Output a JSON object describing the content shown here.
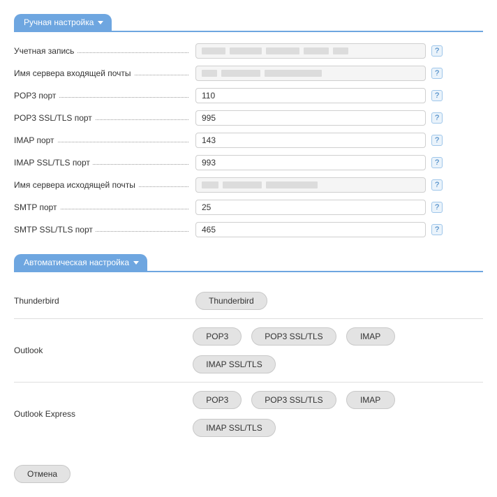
{
  "manual": {
    "header": "Ручная настройка",
    "rows": [
      {
        "label": "Учетная запись",
        "value": "",
        "masked": true,
        "bars": [
          34,
          46,
          48,
          36,
          22
        ]
      },
      {
        "label": "Имя сервера входящей почты",
        "value": "",
        "masked": true,
        "bars": [
          22,
          56,
          82
        ]
      },
      {
        "label": "POP3 порт",
        "value": "110",
        "masked": false
      },
      {
        "label": "POP3 SSL/TLS порт",
        "value": "995",
        "masked": false
      },
      {
        "label": "IMAP порт",
        "value": "143",
        "masked": false
      },
      {
        "label": "IMAP SSL/TLS порт",
        "value": "993",
        "masked": false
      },
      {
        "label": "Имя сервера исходящей почты",
        "value": "",
        "masked": true,
        "bars": [
          24,
          56,
          74
        ]
      },
      {
        "label": "SMTP порт",
        "value": "25",
        "masked": false
      },
      {
        "label": "SMTP SSL/TLS порт",
        "value": "465",
        "masked": false
      }
    ],
    "help_glyph": "?"
  },
  "auto": {
    "header": "Автоматическая настройка",
    "rows": [
      {
        "label": "Thunderbird",
        "buttons": [
          "Thunderbird"
        ]
      },
      {
        "label": "Outlook",
        "buttons": [
          "POP3",
          "POP3 SSL/TLS",
          "IMAP",
          "IMAP SSL/TLS"
        ]
      },
      {
        "label": "Outlook Express",
        "buttons": [
          "POP3",
          "POP3 SSL/TLS",
          "IMAP",
          "IMAP SSL/TLS"
        ]
      }
    ]
  },
  "footer": {
    "cancel": "Отмена"
  }
}
